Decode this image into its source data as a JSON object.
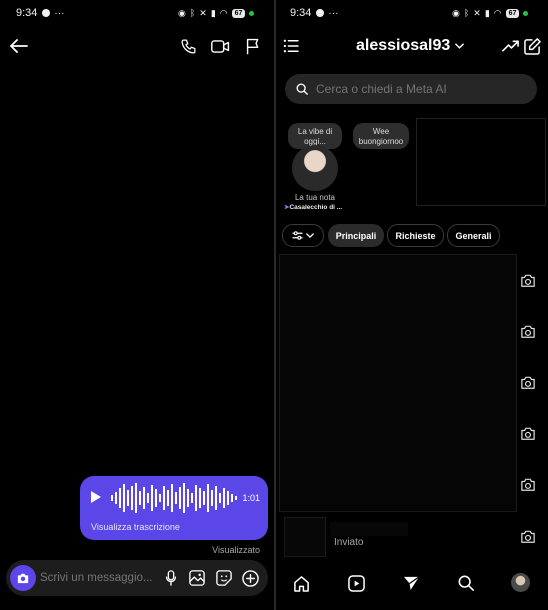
{
  "left": {
    "status": {
      "time": "9:34",
      "battery": "67"
    },
    "voice_message": {
      "duration": "1:01",
      "transcript_link": "Visualizza trascrizione"
    },
    "seen_label": "Visualizzato",
    "composer": {
      "placeholder": "Scrivi un messaggio..."
    }
  },
  "right": {
    "status": {
      "time": "9:34",
      "battery": "67"
    },
    "header": {
      "username": "alessiosal93"
    },
    "search": {
      "placeholder": "Cerca o chiedi a Meta AI"
    },
    "notes": [
      {
        "bubble": "La vibe di oggi...",
        "caption": "La tua nota",
        "location": "Casalecchio di ..."
      },
      {
        "bubble": "Wee buongiornoo"
      }
    ],
    "filters": [
      {
        "label": "Principali",
        "active": true
      },
      {
        "label": "Richieste",
        "active": false
      },
      {
        "label": "Generali",
        "active": false
      }
    ],
    "sent_label": "Inviato"
  },
  "colors": {
    "accent": "#5b47e8",
    "background": "#000000",
    "surface": "#262626"
  }
}
